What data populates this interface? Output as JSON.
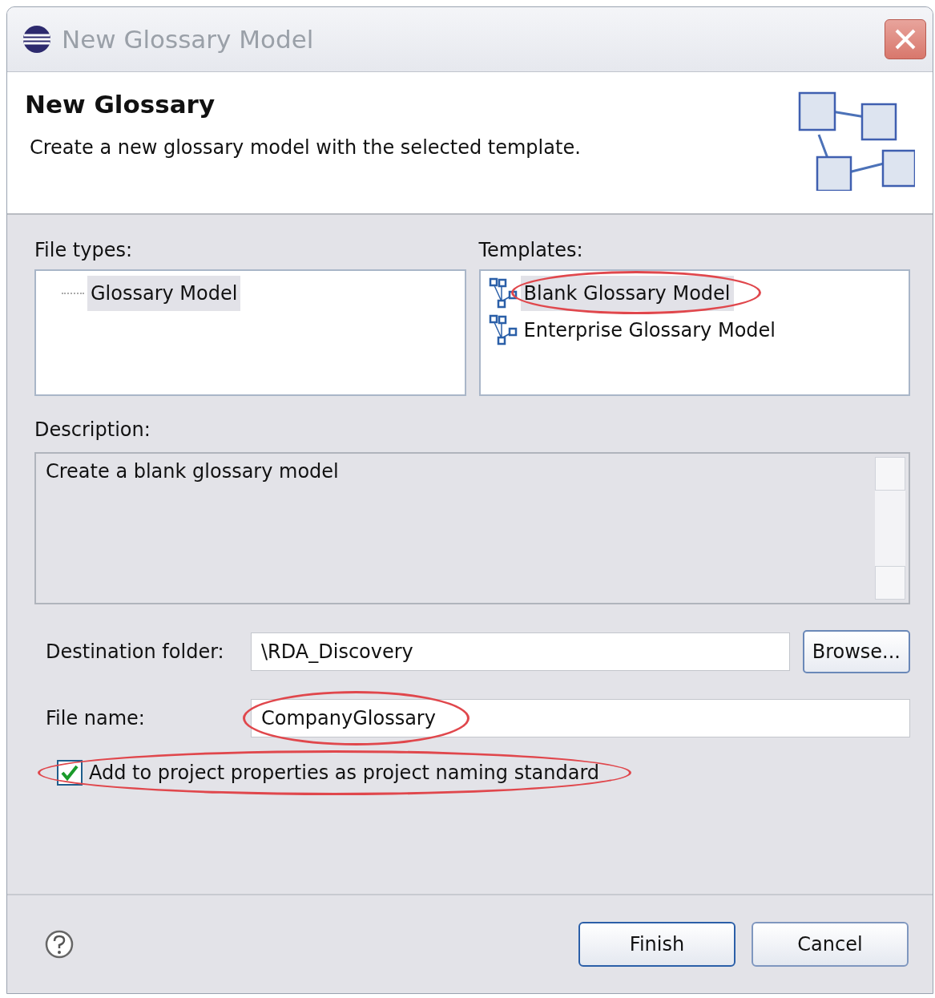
{
  "window": {
    "title": "New Glossary Model"
  },
  "header": {
    "title": "New Glossary",
    "description": "Create a new glossary model with the selected template."
  },
  "file_types": {
    "label": "File types:",
    "items": [
      {
        "label": "Glossary Model",
        "selected": true
      }
    ]
  },
  "templates": {
    "label": "Templates:",
    "items": [
      {
        "label": "Blank Glossary Model",
        "selected": true,
        "circled": true
      },
      {
        "label": "Enterprise Glossary Model",
        "selected": false,
        "circled": false
      }
    ]
  },
  "description": {
    "label": "Description:",
    "value": "Create a blank glossary model"
  },
  "destination": {
    "label": "Destination folder:",
    "value": "\\RDA_Discovery",
    "button": "Browse..."
  },
  "file_name": {
    "label": "File name:",
    "value": "CompanyGlossary",
    "circled": true
  },
  "naming_standard": {
    "label": "Add to project properties as project naming standard",
    "checked": true,
    "circled": true
  },
  "buttons": [
    {
      "label": "Finish",
      "default": true
    },
    {
      "label": "Cancel",
      "default": false
    }
  ]
}
